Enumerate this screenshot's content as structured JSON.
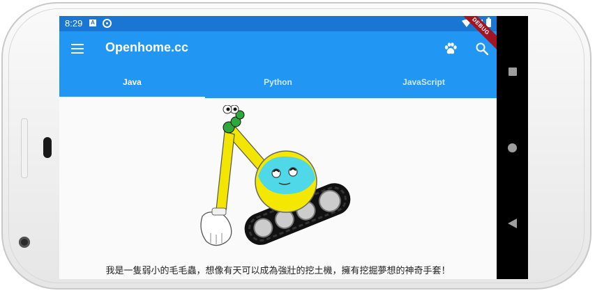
{
  "status_bar": {
    "time": "8:29",
    "notification_glyph": "A",
    "icons": [
      "a-badge-icon",
      "sync-icon",
      "wifi-icon",
      "signal-icon",
      "battery-icon"
    ]
  },
  "debug_banner": "DEBUG",
  "app_bar": {
    "title": "Openhome.cc",
    "left_icon": "menu-icon",
    "actions": [
      "paw-icon",
      "search-icon"
    ]
  },
  "tabs": [
    {
      "label": "Java",
      "selected": true
    },
    {
      "label": "Python",
      "selected": false
    },
    {
      "label": "JavaScript",
      "selected": false
    }
  ],
  "content": {
    "caption": "我是一隻弱小的毛毛蟲，想像有天可以成為強壯的挖土機，擁有挖掘夢想的神奇手套！",
    "illustration": "caterpillar-excavator-image"
  },
  "nav_bar": {
    "buttons": [
      "recent-apps-icon",
      "home-icon",
      "back-icon"
    ]
  },
  "colors": {
    "status_bar": "#1976d2",
    "app_bar": "#2196f3",
    "debug": "#a31422",
    "nav_bar": "#000000"
  }
}
